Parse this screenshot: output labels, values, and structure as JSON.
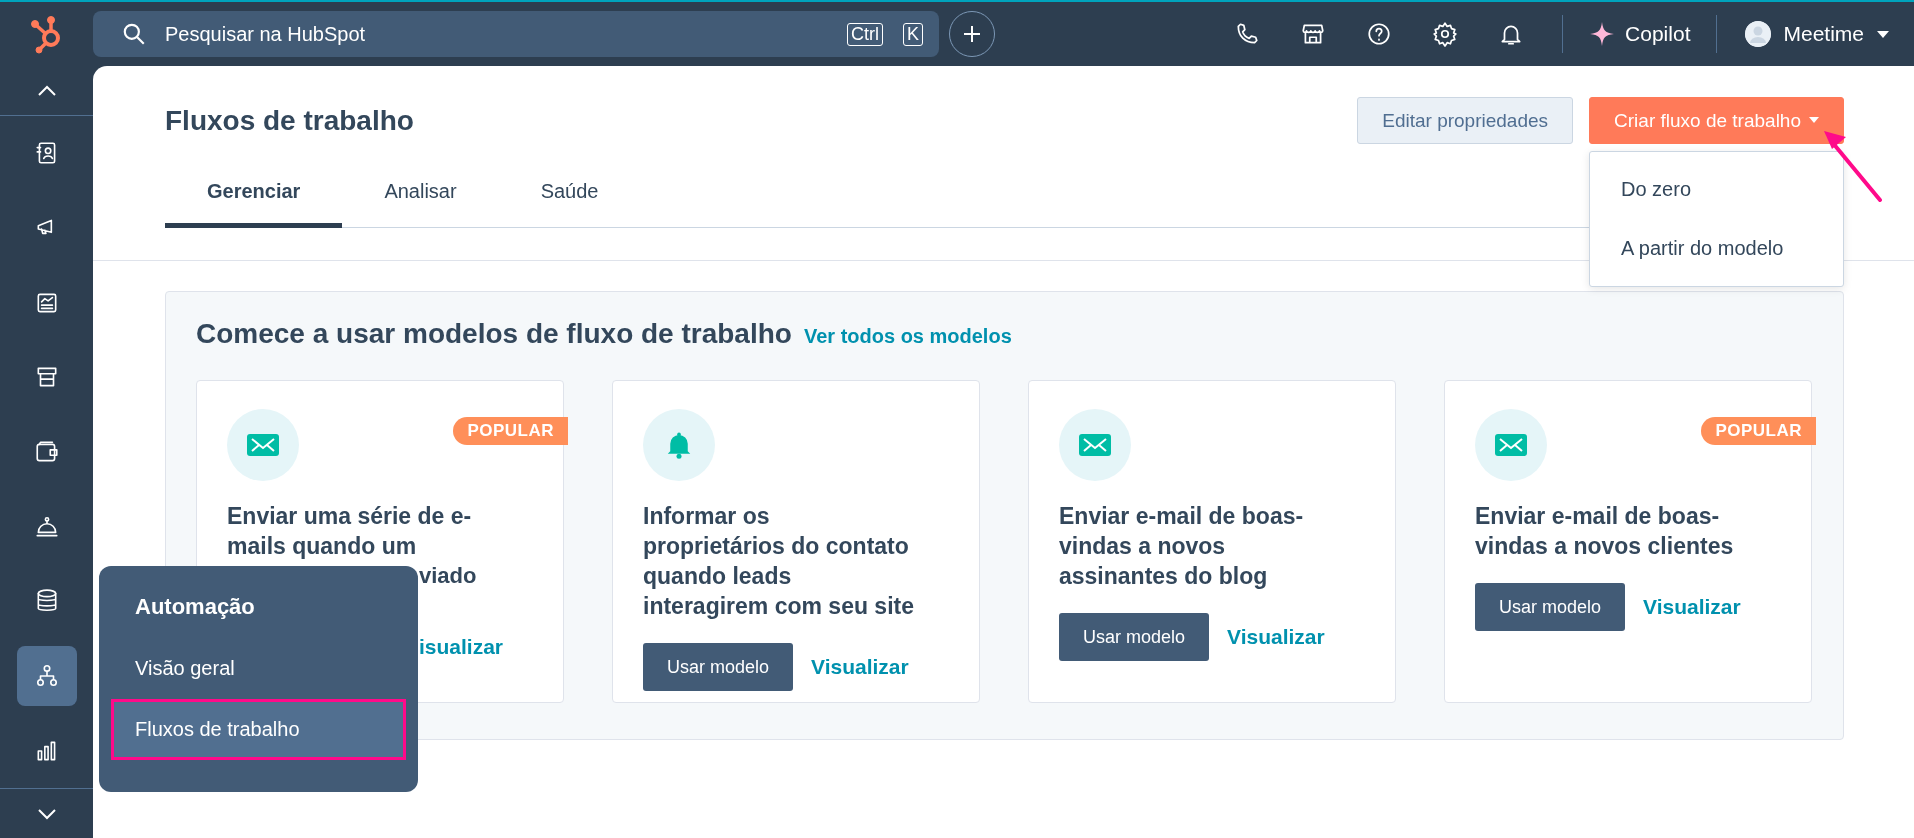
{
  "top_bar": {
    "search": {
      "placeholder": "Pesquisar na HubSpot"
    },
    "shortcut_keys": [
      "Ctrl",
      "K"
    ],
    "copilot": "Copilot",
    "account": "Meetime"
  },
  "sidebar": {
    "items": [
      {
        "selected": false
      },
      {
        "selected": false
      },
      {
        "selected": false
      },
      {
        "selected": false
      },
      {
        "selected": false
      },
      {
        "selected": false
      },
      {
        "selected": false
      },
      {
        "selected": true
      },
      {
        "selected": false
      }
    ]
  },
  "page": {
    "title": "Fluxos de trabalho",
    "secondary_button": "Editar propriedades",
    "primary_button": "Criar fluxo de trabalho",
    "dropdown": [
      "Do zero",
      "A partir do modelo"
    ],
    "tabs": [
      {
        "label": "Gerenciar",
        "selected": true
      },
      {
        "label": "Analisar",
        "selected": false
      },
      {
        "label": "Saúde",
        "selected": false
      }
    ]
  },
  "templates": {
    "heading": "Comece a usar modelos de fluxo de trabalho",
    "link": "Ver todos os modelos",
    "cards": [
      {
        "kind": "email",
        "badge": "POPULAR",
        "title": "Enviar uma série de e-mails quando um",
        "title_tail": "viado",
        "link": "isualizar"
      },
      {
        "kind": "bell",
        "title": "Informar os proprietários do contato quando leads interagirem com seu site",
        "button": "Usar modelo",
        "link": "Visualizar"
      },
      {
        "kind": "email",
        "title": "Enviar e-mail de boas-vindas a novos assinantes do blog",
        "button": "Usar modelo",
        "link": "Visualizar"
      },
      {
        "kind": "email",
        "badge": "POPULAR",
        "title": "Enviar e-mail de boas-vindas a novos clientes",
        "button": "Usar modelo",
        "link": "Visualizar"
      }
    ]
  },
  "flyout": {
    "title": "Automação",
    "items": [
      {
        "label": "Visão geral",
        "selected": false
      },
      {
        "label": "Fluxos de trabalho",
        "selected": true
      }
    ]
  }
}
